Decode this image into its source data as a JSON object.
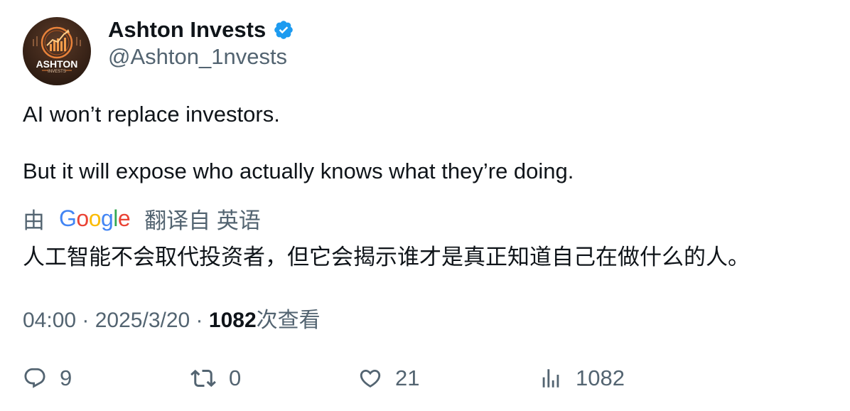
{
  "author": {
    "display_name": "Ashton Invests",
    "handle": "@Ashton_1nvests",
    "verified": true,
    "avatar_text": "ASHTON",
    "avatar_subtext": "INVESTS"
  },
  "tweet": {
    "line1": "AI won’t replace investors.",
    "line2": "But it will expose who actually knows what they’re doing."
  },
  "translation": {
    "prefix": "由",
    "provider_logo": "Google",
    "suffix": "翻译自 英语",
    "text": "人工智能不会取代投资者，但它会揭示谁才是真正知道自己在做什么的人。"
  },
  "meta": {
    "time": "04:00",
    "separator": " · ",
    "date": "2025/3/20",
    "views_count": "1082",
    "views_label": "次查看"
  },
  "actions": {
    "replies": "9",
    "retweets": "0",
    "likes": "21",
    "views": "1082"
  },
  "colors": {
    "verified_badge": "#1d9bf0",
    "text_primary": "#0f1419",
    "text_secondary": "#536471",
    "avatar_accent": "#e8823a"
  }
}
